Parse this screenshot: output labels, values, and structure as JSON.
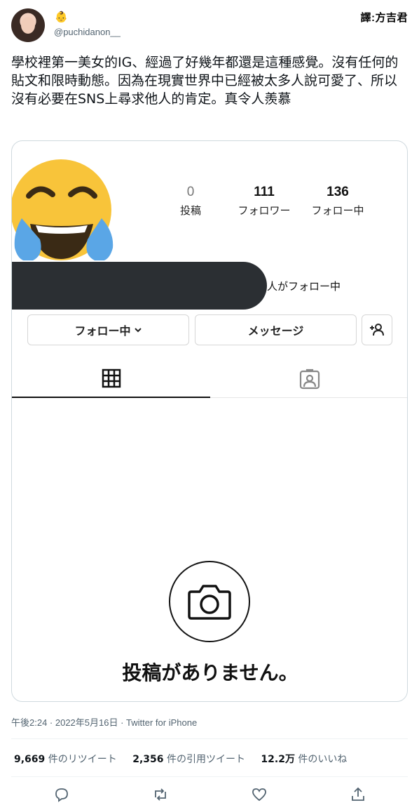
{
  "header": {
    "handle": "@puchidanon__",
    "display_emoji": "👶",
    "translator_tag": "譯:方吉君"
  },
  "tweet": {
    "text": "學校裡第一美女的IG、經過了好幾年都還是這種感覺。沒有任何的貼文和限時動態。因為在現實世界中已經被太多人說可愛了、所以沒有必要在SNS上尋求他人的肯定。真令人羨慕"
  },
  "profile_card": {
    "stats": [
      {
        "value": "0",
        "label": "投稿"
      },
      {
        "value": "111",
        "label": "フォロワー"
      },
      {
        "value": "136",
        "label": "フォロー中"
      }
    ],
    "followed_by_suffix": "人がフォロー中",
    "buttons": {
      "following": "フォロー中",
      "message": "メッセージ"
    },
    "no_posts": "投稿がありません。"
  },
  "meta": {
    "timestamp": "午後2:24 · 2022年5月16日 · Twitter for iPhone"
  },
  "engagement": {
    "retweets_value": "9,669",
    "retweets_label": "件のリツイート",
    "quotes_value": "2,356",
    "quotes_label": "件の引用ツイート",
    "likes_value": "12.2万",
    "likes_label": "件のいいね"
  },
  "icons": {
    "reply": "reply-icon",
    "retweet": "retweet-icon",
    "like": "heart-icon",
    "share": "share-icon"
  }
}
